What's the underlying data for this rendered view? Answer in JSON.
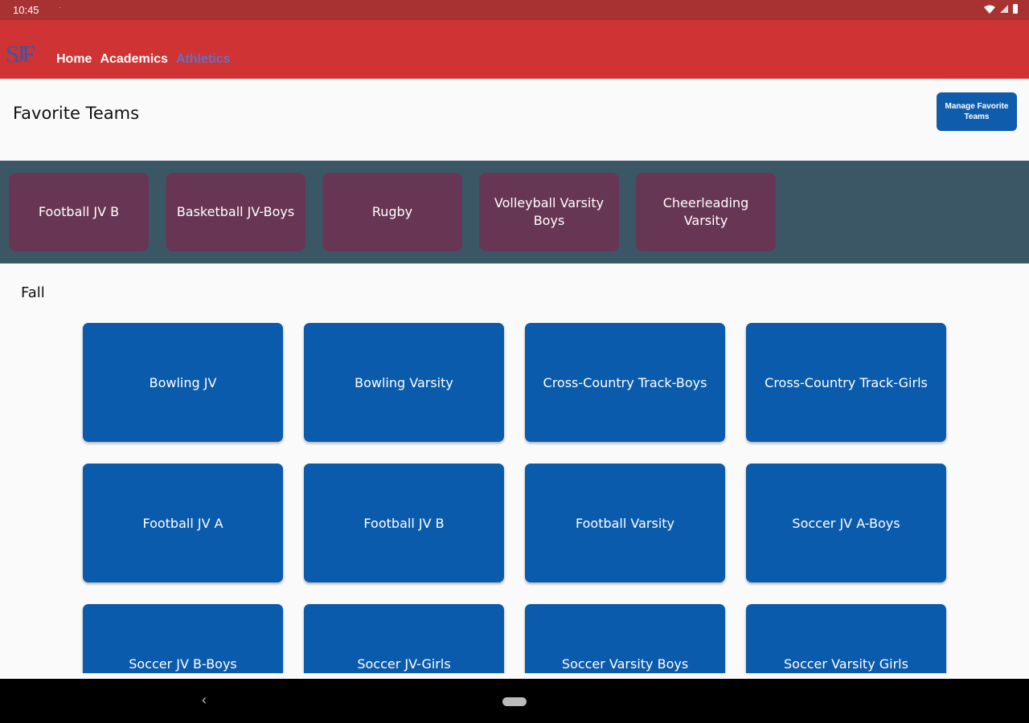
{
  "status_bar": {
    "time": "10:45",
    "dot": "·"
  },
  "app": {
    "logo": "SJF"
  },
  "nav": {
    "items": [
      {
        "label": "Home",
        "active": false
      },
      {
        "label": "Academics",
        "active": false
      },
      {
        "label": "Athletics",
        "active": true
      }
    ]
  },
  "favorites": {
    "title": "Favorite Teams",
    "manage_button": "Manage Favorite Teams",
    "teams": [
      "Football JV B",
      "Basketball JV-Boys",
      "Rugby",
      "Volleyball Varsity Boys",
      "Cheerleading Varsity"
    ]
  },
  "section": {
    "title": "Fall",
    "teams": [
      "Bowling JV",
      "Bowling Varsity",
      "Cross-Country Track-Boys",
      "Cross-Country Track-Girls",
      "Football JV A",
      "Football JV B",
      "Football Varsity",
      "Soccer JV A-Boys",
      "Soccer JV B-Boys",
      "Soccer JV-Girls",
      "Soccer Varsity Boys",
      "Soccer Varsity Girls"
    ]
  },
  "colors": {
    "status_bar": "#a83232",
    "app_bar": "#d03333",
    "favorite_strip": "#3b5766",
    "favorite_card": "#683655",
    "team_card": "#0a5bab",
    "active_nav": "#5a74c8"
  }
}
